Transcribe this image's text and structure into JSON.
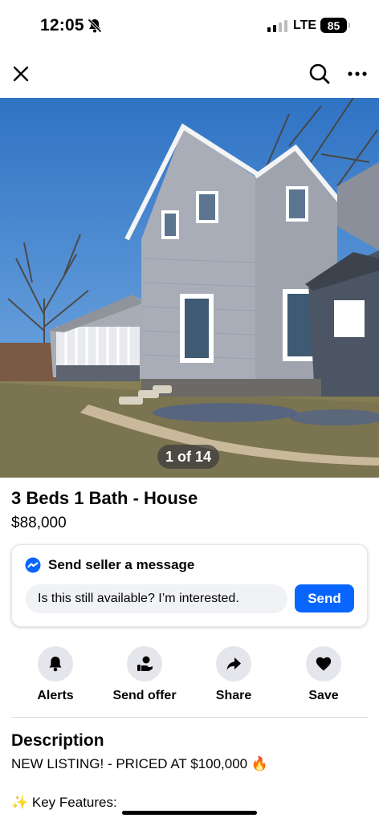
{
  "status_bar": {
    "time": "12:05",
    "network": "LTE",
    "battery": "85",
    "icons": [
      "bell-slash-icon",
      "signal-icon"
    ]
  },
  "nav": {
    "icons": [
      "close-icon",
      "search-icon",
      "more-icon"
    ]
  },
  "photo": {
    "counter": "1 of 14"
  },
  "listing": {
    "title": "3 Beds 1 Bath - House",
    "price": "$88,000"
  },
  "message": {
    "header": "Send seller a message",
    "input_value": "Is this still available? I’m interested.",
    "send_label": "Send",
    "icon": "messenger-icon"
  },
  "actions": [
    {
      "label": "Alerts",
      "icon": "bell-icon"
    },
    {
      "label": "Send offer",
      "icon": "offer-icon"
    },
    {
      "label": "Share",
      "icon": "share-icon"
    },
    {
      "label": "Save",
      "icon": "heart-icon"
    }
  ],
  "description": {
    "heading": "Description",
    "line1": "NEW LISTING! - PRICED AT $100,000 🔥",
    "line2": "✨ Key Features:"
  },
  "colors": {
    "accent": "#0866ff",
    "text": "#050505",
    "chip_bg": "#e4e6eb",
    "input_bg": "#f0f2f5"
  }
}
